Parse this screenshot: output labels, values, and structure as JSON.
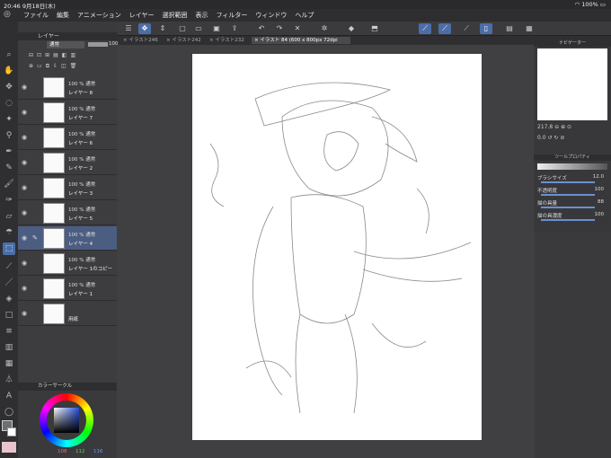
{
  "status": {
    "time": "20:46",
    "date": "9月18日(木)",
    "battery": "100%"
  },
  "menu": [
    "ファイル",
    "編集",
    "アニメーション",
    "レイヤー",
    "選択範囲",
    "表示",
    "フィルター",
    "ウィンドウ",
    "ヘルプ"
  ],
  "tabs": [
    {
      "label": "× イラスト246",
      "active": false
    },
    {
      "label": "× イラスト242",
      "active": false
    },
    {
      "label": "× イラスト232",
      "active": false
    },
    {
      "label": "× イラスト 84 (600 x 800px 72dpi 217.8%)",
      "active": true
    }
  ],
  "layer_panel": {
    "title": "レイヤー",
    "blend_mode": "通常",
    "opacity": "100",
    "layers": [
      {
        "opacity": "100 %  通常",
        "name": "レイヤー 8",
        "selected": false
      },
      {
        "opacity": "100 %  通常",
        "name": "レイヤー 7",
        "selected": false
      },
      {
        "opacity": "100 %  通常",
        "name": "レイヤー 6",
        "selected": false
      },
      {
        "opacity": "100 %  通常",
        "name": "レイヤー 2",
        "selected": false
      },
      {
        "opacity": "100 %  通常",
        "name": "レイヤー 3",
        "selected": false
      },
      {
        "opacity": "100 %  通常",
        "name": "レイヤー 5",
        "selected": false
      },
      {
        "opacity": "100 %  通常",
        "name": "レイヤー 4",
        "selected": true
      },
      {
        "opacity": "100 %  通常",
        "name": "レイヤー 1のコピー",
        "selected": false
      },
      {
        "opacity": "100 %  通常",
        "name": "レイヤー 1",
        "selected": false
      },
      {
        "opacity": "",
        "name": "用紙",
        "selected": false
      }
    ]
  },
  "color_panel": {
    "title": "カラーサークル",
    "r": "108",
    "g": "112",
    "b": "116"
  },
  "navigator": {
    "title": "ナビゲーター",
    "zoom": "217.8",
    "angle": "0.0"
  },
  "tool_property": {
    "title": "ツールプロパティ",
    "props": [
      {
        "label": "ブラシサイズ",
        "value": "12.0"
      },
      {
        "label": "不透明度",
        "value": "100"
      },
      {
        "label": "描の具量",
        "value": "88"
      },
      {
        "label": "描の具濃度",
        "value": "100"
      }
    ]
  }
}
